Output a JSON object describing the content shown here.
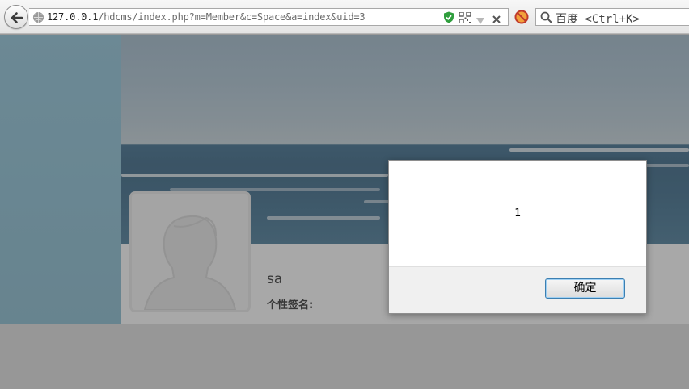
{
  "browser": {
    "url_host": "127.0.0.1",
    "url_path": "/hdcms/index.php?m=Member&c=Space&a=index&uid=3",
    "search_placeholder": "百度 <Ctrl+K>"
  },
  "profile": {
    "username": "sa",
    "signature_label": "个性签名:"
  },
  "dialog": {
    "message": "1",
    "ok_label": "确定"
  },
  "colors": {
    "shield_green": "#2f9e3d",
    "dialog_button_border": "#3c7fb1"
  }
}
